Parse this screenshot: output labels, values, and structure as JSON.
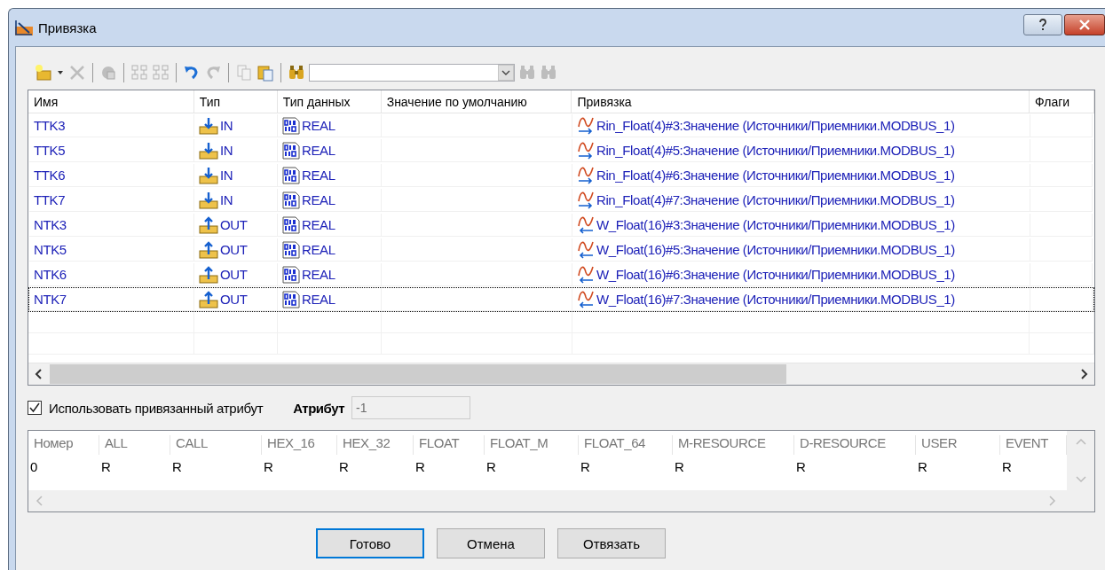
{
  "window": {
    "title": "Привязка"
  },
  "toolbar": [
    {
      "kind": "new",
      "disabled": false
    },
    {
      "kind": "dropdown",
      "disabled": false
    },
    {
      "kind": "delete",
      "disabled": true
    },
    {
      "kind": "sep"
    },
    {
      "kind": "export",
      "disabled": true
    },
    {
      "kind": "sep"
    },
    {
      "kind": "tree-expand",
      "disabled": true
    },
    {
      "kind": "tree-collapse",
      "disabled": true
    },
    {
      "kind": "sep"
    },
    {
      "kind": "undo",
      "disabled": false
    },
    {
      "kind": "redo",
      "disabled": true
    },
    {
      "kind": "sep"
    },
    {
      "kind": "copy",
      "disabled": true
    },
    {
      "kind": "paste",
      "disabled": false
    },
    {
      "kind": "sep"
    },
    {
      "kind": "find",
      "disabled": false
    },
    {
      "kind": "search-box"
    },
    {
      "kind": "find-next",
      "disabled": true
    },
    {
      "kind": "find-prev",
      "disabled": true
    }
  ],
  "table": {
    "columns": [
      "Имя",
      "Тип",
      "Тип данных",
      "Значение по умолчанию",
      "Привязка",
      "Флаги"
    ],
    "rows": [
      {
        "name": "TTK3",
        "kind": "in",
        "type": "IN",
        "data_type": "REAL",
        "binding": "Rin_Float(4)#3:Значение (Источники/Приемники.MODBUS_1)",
        "selected": false
      },
      {
        "name": "TTK5",
        "kind": "in",
        "type": "IN",
        "data_type": "REAL",
        "binding": "Rin_Float(4)#5:Значение (Источники/Приемники.MODBUS_1)",
        "selected": false
      },
      {
        "name": "TTK6",
        "kind": "in",
        "type": "IN",
        "data_type": "REAL",
        "binding": "Rin_Float(4)#6:Значение (Источники/Приемники.MODBUS_1)",
        "selected": false
      },
      {
        "name": "TTK7",
        "kind": "in",
        "type": "IN",
        "data_type": "REAL",
        "binding": "Rin_Float(4)#7:Значение (Источники/Приемники.MODBUS_1)",
        "selected": false
      },
      {
        "name": "NTK3",
        "kind": "out",
        "type": "OUT",
        "data_type": "REAL",
        "binding": "W_Float(16)#3:Значение (Источники/Приемники.MODBUS_1)",
        "selected": false
      },
      {
        "name": "NTK5",
        "kind": "out",
        "type": "OUT",
        "data_type": "REAL",
        "binding": "W_Float(16)#5:Значение (Источники/Приемники.MODBUS_1)",
        "selected": false
      },
      {
        "name": "NTK6",
        "kind": "out",
        "type": "OUT",
        "data_type": "REAL",
        "binding": "W_Float(16)#6:Значение (Источники/Приемники.MODBUS_1)",
        "selected": false
      },
      {
        "name": "NTK7",
        "kind": "out",
        "type": "OUT",
        "data_type": "REAL",
        "binding": "W_Float(16)#7:Значение (Источники/Приемники.MODBUS_1)",
        "selected": true
      }
    ]
  },
  "use_bound_attribute": {
    "label": "Использовать привязанный атрибут",
    "checked": true
  },
  "attribute": {
    "label": "Атрибут",
    "value": "-1",
    "disabled": true
  },
  "attributes_table": {
    "columns": [
      "Номер",
      "ALL",
      "CALL",
      "HEX_16",
      "HEX_32",
      "FLOAT",
      "FLOAT_M",
      "FLOAT_64",
      "M-RESOURCE",
      "D-RESOURCE",
      "USER",
      "EVENT"
    ],
    "rows": [
      [
        "0",
        "R",
        "R",
        "R",
        "R",
        "R",
        "R",
        "R",
        "R",
        "R",
        "R",
        "R"
      ]
    ]
  },
  "buttons": [
    {
      "label": "Готово",
      "focused": true
    },
    {
      "label": "Отмена",
      "focused": false
    },
    {
      "label": "Отвязать",
      "focused": false
    }
  ]
}
